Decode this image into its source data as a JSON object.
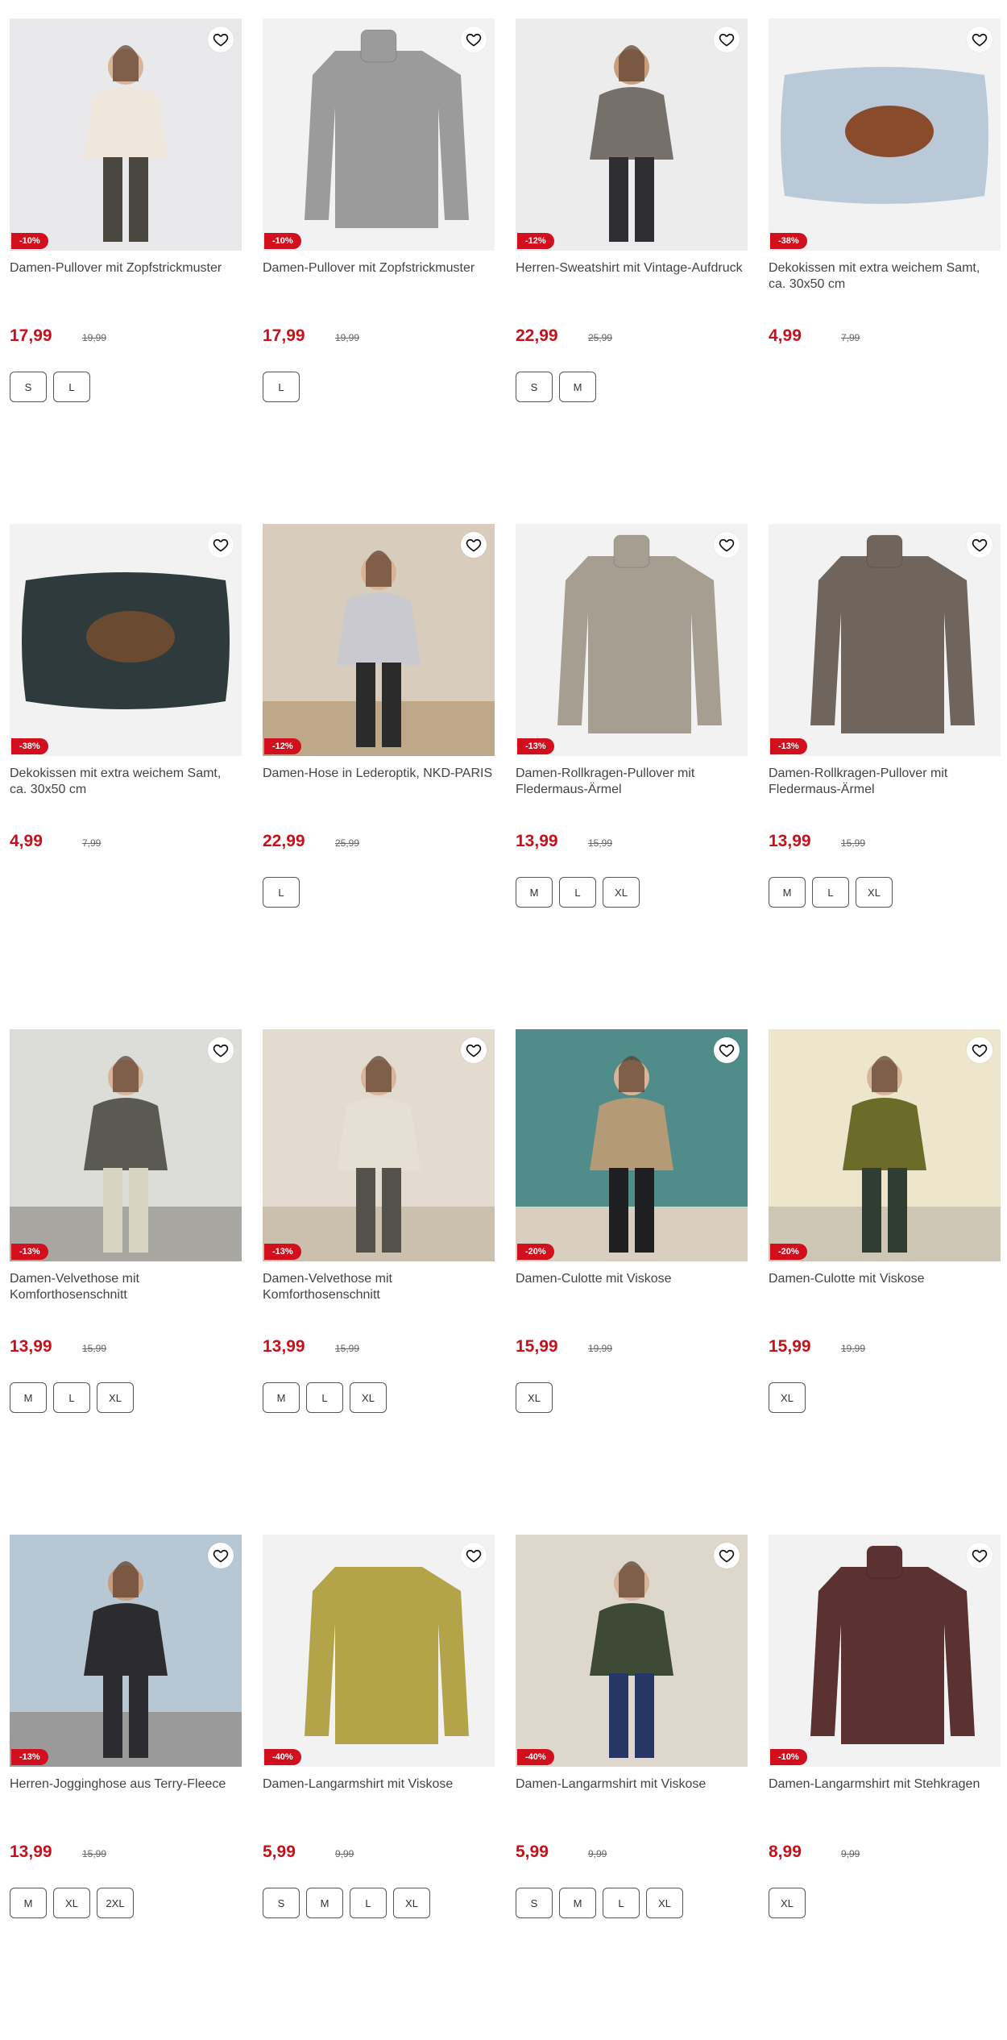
{
  "products": [
    {
      "title": "Damen-Pullover mit Zopfstrickmuster",
      "price": "17,99",
      "old_price": "19,99",
      "discount": "-10%",
      "sizes": [
        "S",
        "L"
      ],
      "image": "woman-cream-cable-sweater"
    },
    {
      "title": "Damen-Pullover mit Zopfstrickmuster",
      "price": "17,99",
      "old_price": "19,99",
      "discount": "-10%",
      "sizes": [
        "L"
      ],
      "image": "grey-turtleneck-sweater"
    },
    {
      "title": "Herren-Sweatshirt mit Vintage-Aufdruck",
      "price": "22,99",
      "old_price": "25,99",
      "discount": "-12%",
      "sizes": [
        "S",
        "M"
      ],
      "image": "man-vintage-hoodie"
    },
    {
      "title": "Dekokissen mit extra weichem Samt, ca. 30x50 cm",
      "price": "4,99",
      "old_price": "7,99",
      "discount": "-38%",
      "sizes": [],
      "image": "horse-cushion"
    },
    {
      "title": "Dekokissen mit extra weichem Samt, ca. 30x50 cm",
      "price": "4,99",
      "old_price": "7,99",
      "discount": "-38%",
      "sizes": [],
      "image": "deer-cushion"
    },
    {
      "title": "Damen-Hose in Lederoptik, NKD-PARIS",
      "price": "22,99",
      "old_price": "25,99",
      "discount": "-12%",
      "sizes": [
        "L"
      ],
      "image": "woman-leather-pants-stairs"
    },
    {
      "title": "Damen-Rollkragen-Pullover mit Fledermaus-Ärmel",
      "price": "13,99",
      "old_price": "15,99",
      "discount": "-13%",
      "sizes": [
        "M",
        "L",
        "XL"
      ],
      "image": "beige-rollneck"
    },
    {
      "title": "Damen-Rollkragen-Pullover mit Fledermaus-Ärmel",
      "price": "13,99",
      "old_price": "15,99",
      "discount": "-13%",
      "sizes": [
        "M",
        "L",
        "XL"
      ],
      "image": "brown-rollneck"
    },
    {
      "title": "Damen-Velvethose mit Komforthosenschnitt",
      "price": "13,99",
      "old_price": "15,99",
      "discount": "-13%",
      "sizes": [
        "M",
        "L",
        "XL"
      ],
      "image": "woman-street-cardigan"
    },
    {
      "title": "Damen-Velvethose mit Komforthosenschnitt",
      "price": "13,99",
      "old_price": "15,99",
      "discount": "-13%",
      "sizes": [
        "M",
        "L",
        "XL"
      ],
      "image": "woman-sofa-room"
    },
    {
      "title": "Damen-Culotte mit Viskose",
      "price": "15,99",
      "old_price": "19,99",
      "discount": "-20%",
      "sizes": [
        "XL"
      ],
      "image": "woman-teal-room"
    },
    {
      "title": "Damen-Culotte mit Viskose",
      "price": "15,99",
      "old_price": "19,99",
      "discount": "-20%",
      "sizes": [
        "XL"
      ],
      "image": "woman-green-culotte"
    },
    {
      "title": "Herren-Jogginghose aus Terry-Fleece",
      "price": "13,99",
      "old_price": "15,99",
      "discount": "-13%",
      "sizes": [
        "M",
        "XL",
        "2XL"
      ],
      "image": "man-jogging-city"
    },
    {
      "title": "Damen-Langarmshirt mit Viskose",
      "price": "5,99",
      "old_price": "9,99",
      "discount": "-40%",
      "sizes": [
        "S",
        "M",
        "L",
        "XL"
      ],
      "image": "zebra-print-shirt"
    },
    {
      "title": "Damen-Langarmshirt mit Viskose",
      "price": "5,99",
      "old_price": "9,99",
      "discount": "-40%",
      "sizes": [
        "S",
        "M",
        "L",
        "XL"
      ],
      "image": "woman-green-print-shirt"
    },
    {
      "title": "Damen-Langarmshirt mit Stehkragen",
      "price": "8,99",
      "old_price": "9,99",
      "discount": "-10%",
      "sizes": [
        "XL"
      ],
      "image": "burgundy-snake-shirt"
    }
  ],
  "colors": {
    "price": "#c8101a",
    "badge": "#d20f1c"
  },
  "icons": {
    "wishlist": "heart-icon"
  }
}
